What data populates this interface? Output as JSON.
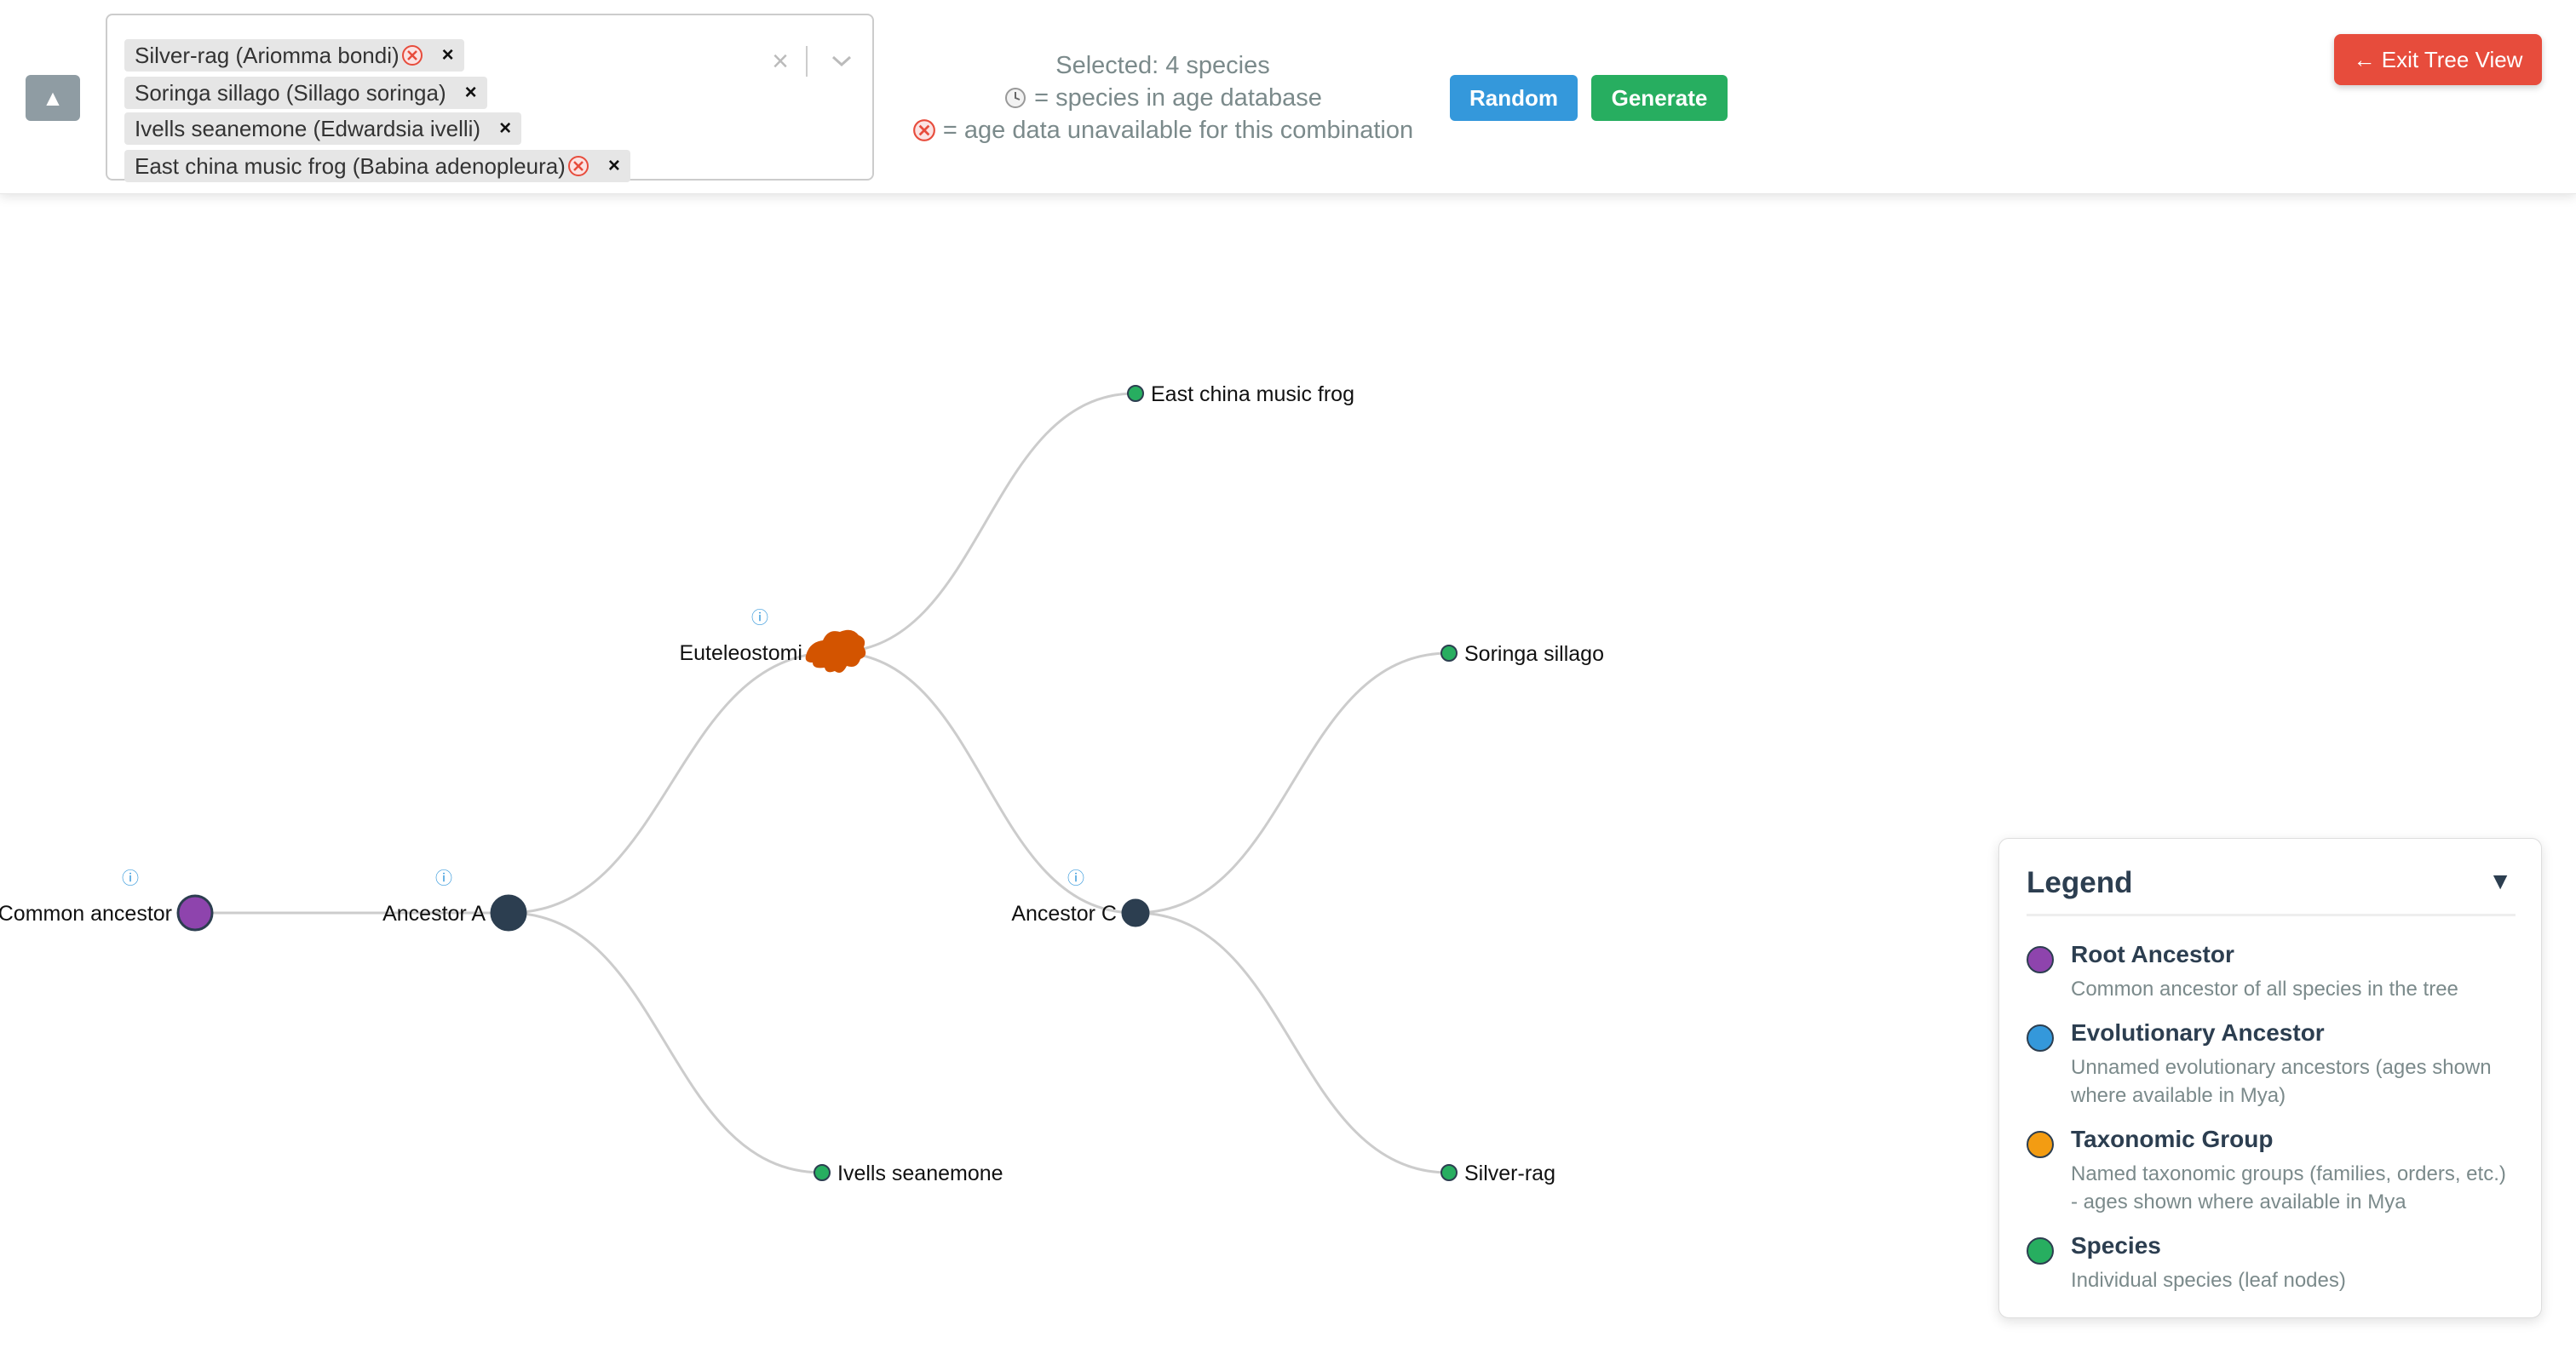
{
  "header": {
    "collapse_label": "▲",
    "selected_species": [
      {
        "label": "Silver-rag (Ariomma bondi)",
        "age_unavailable": true
      },
      {
        "label": "Soringa sillago (Sillago soringa)",
        "age_unavailable": false
      },
      {
        "label": "Ivells seanemone (Edwardsia ivelli)",
        "age_unavailable": false
      },
      {
        "label": "East china music frog (Babina adenopleura)",
        "age_unavailable": true
      }
    ],
    "chip_remove_glyph": "×",
    "clear_all_glyph": "×",
    "status": {
      "selected_count": "Selected: 4 species",
      "clock_note": "= species in age database",
      "unavailable_note": "= age data unavailable for this combination"
    },
    "random_label": "Random",
    "generate_label": "Generate",
    "exit_label": "← Exit Tree View"
  },
  "tree": {
    "nodes": [
      {
        "id": "root",
        "label": "Common ancestor",
        "type": "root",
        "info": true
      },
      {
        "id": "anc_a",
        "label": "Ancestor A",
        "type": "ancestor",
        "info": true
      },
      {
        "id": "eutel",
        "label": "Euteleostomi",
        "type": "taxon",
        "info": true,
        "icon": "frog-silhouette-icon"
      },
      {
        "id": "anc_c",
        "label": "Ancestor C",
        "type": "ancestor",
        "info": true
      },
      {
        "id": "frog",
        "label": "East china music frog",
        "type": "species"
      },
      {
        "id": "soringa",
        "label": "Soringa sillago",
        "type": "species"
      },
      {
        "id": "seanemone",
        "label": "Ivells seanemone",
        "type": "species"
      },
      {
        "id": "silverrag",
        "label": "Silver-rag",
        "type": "species"
      }
    ],
    "edges": [
      [
        "root",
        "anc_a"
      ],
      [
        "anc_a",
        "eutel"
      ],
      [
        "anc_a",
        "seanemone"
      ],
      [
        "eutel",
        "frog"
      ],
      [
        "eutel",
        "anc_c"
      ],
      [
        "anc_c",
        "soringa"
      ],
      [
        "anc_c",
        "silverrag"
      ]
    ],
    "info_glyph": "ⓘ",
    "colors": {
      "root": "#8e44ad",
      "ancestor": "#2c3e50",
      "species": "#27ae60",
      "taxon_icon": "#d35400",
      "edge": "#cccccc"
    }
  },
  "legend": {
    "title": "Legend",
    "toggle_glyph": "▼",
    "items": [
      {
        "name": "Root Ancestor",
        "desc": "Common ancestor of all species in the tree",
        "color": "#8e44ad"
      },
      {
        "name": "Evolutionary Ancestor",
        "desc": "Unnamed evolutionary ancestors (ages shown where available in Mya)",
        "color": "#3498db"
      },
      {
        "name": "Taxonomic Group",
        "desc": "Named taxonomic groups (families, orders, etc.) - ages shown where available in Mya",
        "color": "#f39c12"
      },
      {
        "name": "Species",
        "desc": "Individual species (leaf nodes)",
        "color": "#27ae60"
      }
    ]
  }
}
